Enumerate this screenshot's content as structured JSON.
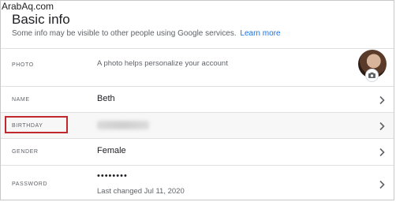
{
  "watermark": "ArabAq.com",
  "header": {
    "title": "Basic info",
    "subtitle": "Some info may be visible to other people using Google services.",
    "learn_more": "Learn more"
  },
  "rows": {
    "photo": {
      "label": "PHOTO",
      "description": "A photo helps personalize your account"
    },
    "name": {
      "label": "NAME",
      "value": "Beth"
    },
    "birthday": {
      "label": "BIRTHDAY"
    },
    "gender": {
      "label": "GENDER",
      "value": "Female"
    },
    "password": {
      "label": "PASSWORD",
      "value": "••••••••",
      "last_changed": "Last changed Jul 11, 2020"
    }
  },
  "colors": {
    "link": "#1a73e8",
    "highlight": "#c0282e",
    "text": "#202124",
    "muted": "#5f6368"
  },
  "icons": [
    "chevron-right-icon",
    "camera-icon"
  ]
}
